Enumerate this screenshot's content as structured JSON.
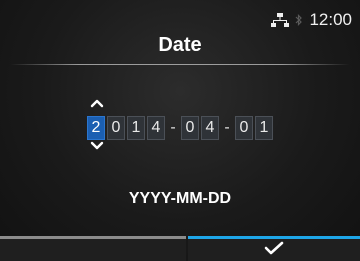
{
  "status": {
    "time": "12:00",
    "network_icon": "network-icon",
    "bluetooth_icon": "bluetooth-icon"
  },
  "title": "Date",
  "date": {
    "year": [
      "2",
      "0",
      "1",
      "4"
    ],
    "month": [
      "0",
      "4"
    ],
    "day": [
      "0",
      "1"
    ],
    "separator": "-",
    "active_digit": "year.0"
  },
  "format_label": "YYYY-MM-DD",
  "buttons": {
    "left": {
      "icon": ""
    },
    "right": {
      "icon": "check-icon"
    }
  },
  "colors": {
    "accent": "#1ea6e8",
    "active_digit_bg": "#1b5fb2",
    "left_bar": "#8c8c8c"
  }
}
